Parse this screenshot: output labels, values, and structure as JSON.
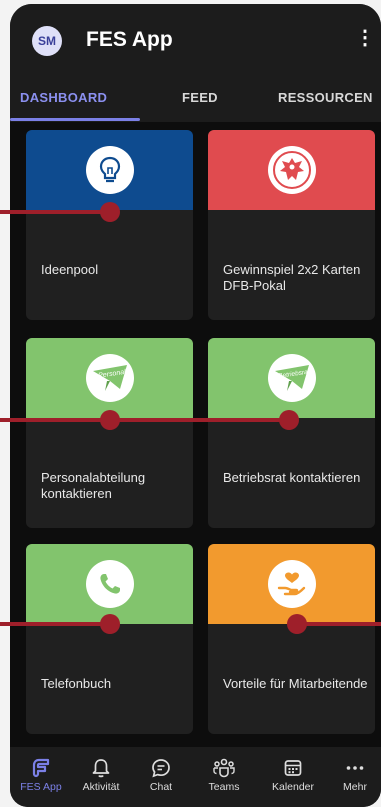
{
  "app": {
    "avatar_initials": "SM",
    "title": "FES App",
    "menu_glyph": "⋮"
  },
  "tabs": [
    {
      "label": "DASHBOARD",
      "active": true
    },
    {
      "label": "FEED",
      "active": false
    },
    {
      "label": "RESSOURCEN",
      "active": false
    }
  ],
  "tiles": [
    {
      "label": "Ideenpool",
      "color": "#0e4b8f",
      "icon": "lightbulb-icon"
    },
    {
      "label": "Gewinnspiel 2x2 Karten DFB-Pokal",
      "color": "#e04b4f",
      "icon": "eagle-crest-icon"
    },
    {
      "label": "Personalabteilung kontaktieren",
      "color": "#82c46d",
      "icon": "paper-plane-icon",
      "icon_text": "Personal"
    },
    {
      "label": "Betriebsrat kontaktieren",
      "color": "#82c46d",
      "icon": "paper-plane-icon",
      "icon_text": "Betriebsrat"
    },
    {
      "label": "Telefonbuch",
      "color": "#82c46d",
      "icon": "phone-icon"
    },
    {
      "label": "Vorteile für Mitarbeitende",
      "color": "#f29a2e",
      "icon": "hand-heart-icon"
    }
  ],
  "bottom_nav": [
    {
      "label": "FES App",
      "icon": "fes-app-icon",
      "active": true
    },
    {
      "label": "Aktivität",
      "icon": "bell-icon",
      "active": false
    },
    {
      "label": "Chat",
      "icon": "chat-icon",
      "active": false
    },
    {
      "label": "Teams",
      "icon": "teams-icon",
      "active": false
    },
    {
      "label": "Kalender",
      "icon": "calendar-icon",
      "active": false
    },
    {
      "label": "Mehr",
      "icon": "more-icon",
      "active": false
    }
  ],
  "colors": {
    "accent": "#7b80e6",
    "annotation": "#9e1f2a",
    "background": "#0d0d0d"
  }
}
